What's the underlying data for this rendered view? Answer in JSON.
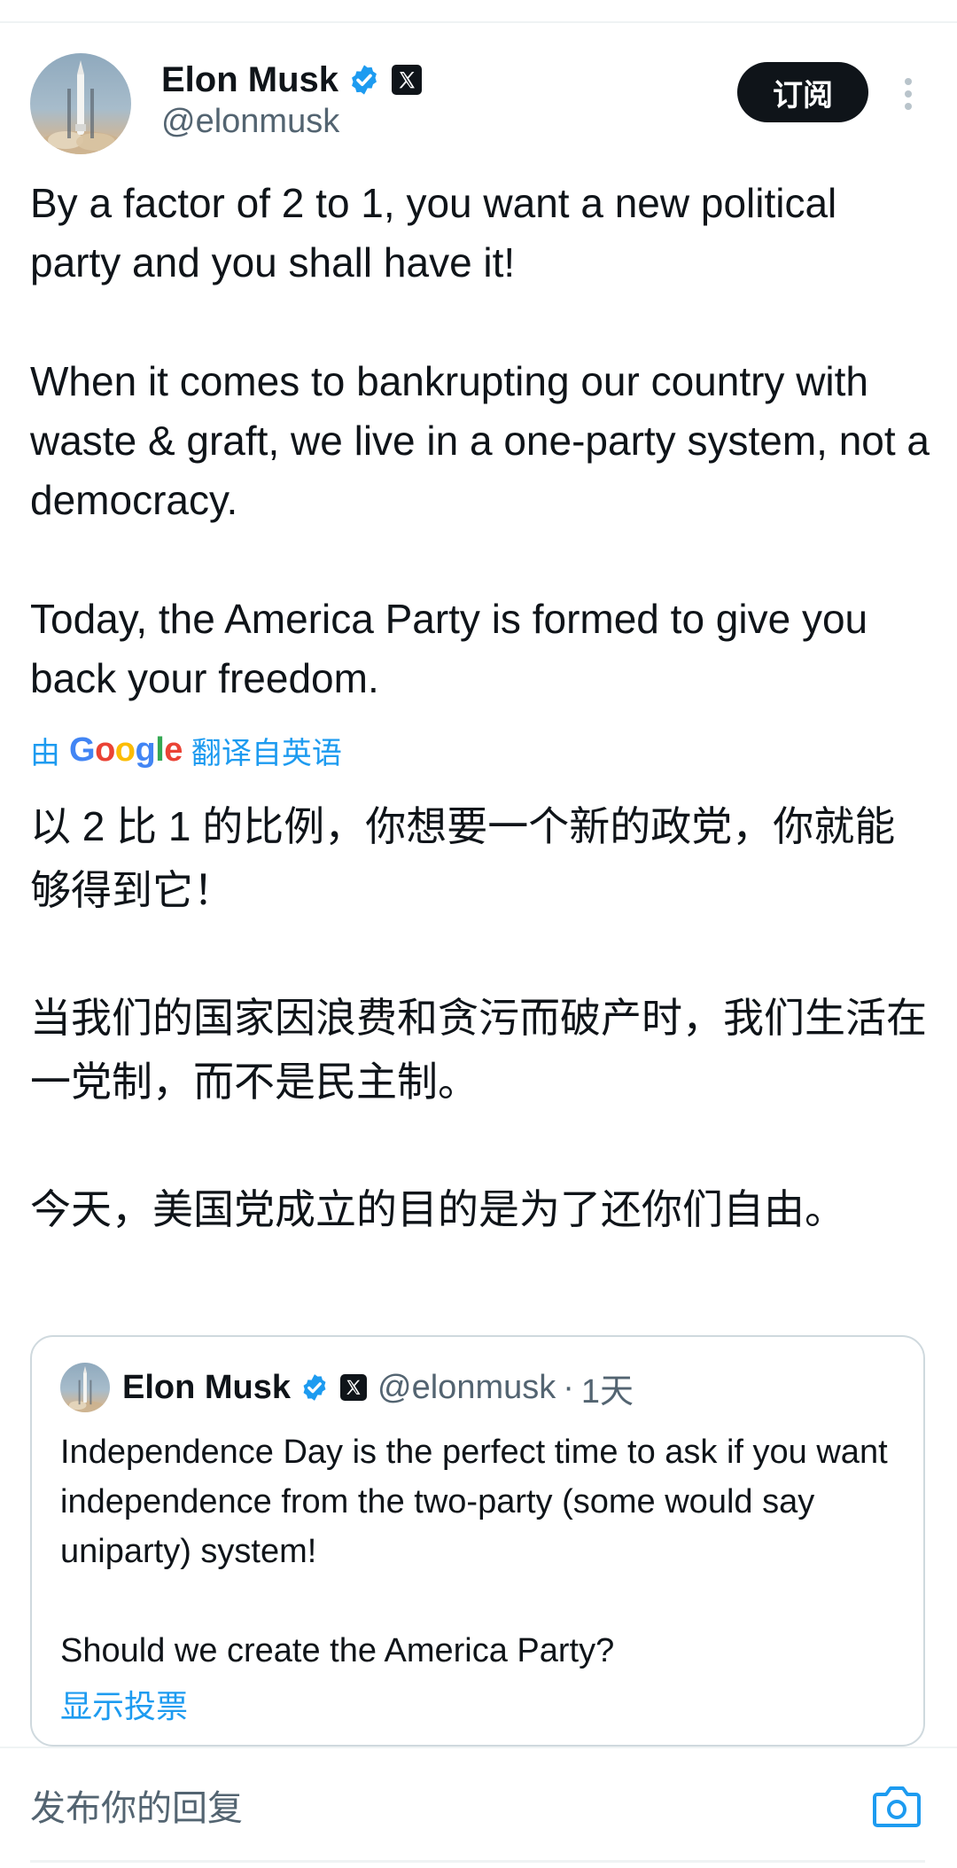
{
  "tweet": {
    "author": {
      "display_name": "Elon Musk",
      "handle": "@elonmusk",
      "verified_icon": "verified-badge-icon",
      "affiliate_icon": "x-logo-icon"
    },
    "subscribe_label": "订阅",
    "more_icon": "more-vertical-icon",
    "text": "By a factor of 2 to 1, you want a new political party and you shall have it!\n\nWhen it comes to bankrupting our country with waste & graft, we live in a one-party system, not a democracy.\n\nToday, the America Party is formed to give you back your freedom.",
    "translation": {
      "prefix": "由",
      "provider": "Google",
      "suffix": "翻译自英语",
      "text": "以 2 比 1 的比例，你想要一个新的政党，你就能够得到它！\n\n当我们的国家因浪费和贪污而破产时，我们生活在一党制，而不是民主制。\n\n今天，美国党成立的目的是为了还你们自由。"
    },
    "quoted_tweet": {
      "display_name": "Elon Musk",
      "handle": "@elonmusk",
      "separator": "·",
      "time": "1天",
      "text": "Independence Day is the perfect time to ask if you want independence from the two-party (some would say uniparty) system!\n\nShould we create the America Party?",
      "show_poll_label": "显示投票"
    }
  },
  "reply_bar": {
    "placeholder": "发布你的回复",
    "camera_icon": "camera-icon"
  },
  "colors": {
    "accent": "#1d9bf0",
    "text_primary": "#0f1419",
    "text_secondary": "#536471",
    "border": "#cfd9de",
    "google_blue": "#4285f4",
    "google_red": "#ea4335",
    "google_yellow": "#fbbc05",
    "google_green": "#34a853"
  }
}
